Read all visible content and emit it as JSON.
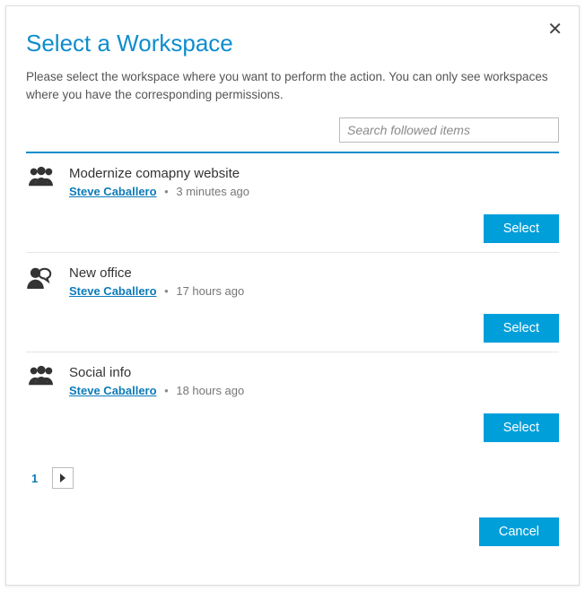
{
  "dialog": {
    "title": "Select a Workspace",
    "subtitle": "Please select the workspace where you want to perform the action. You can only see workspaces where you have the corresponding permissions.",
    "search_placeholder": "Search followed items"
  },
  "items": [
    {
      "icon": "group",
      "title": "Modernize comapny website",
      "author": "Steve Caballero",
      "time": "3 minutes ago",
      "action": "Select"
    },
    {
      "icon": "person-talk",
      "title": "New office",
      "author": "Steve Caballero",
      "time": "17 hours ago",
      "action": "Select"
    },
    {
      "icon": "group",
      "title": "Social info",
      "author": "Steve Caballero",
      "time": "18 hours ago",
      "action": "Select"
    }
  ],
  "pager": {
    "current": "1"
  },
  "buttons": {
    "cancel": "Cancel"
  },
  "colors": {
    "accent": "#009fda",
    "link": "#0d7bb8"
  }
}
